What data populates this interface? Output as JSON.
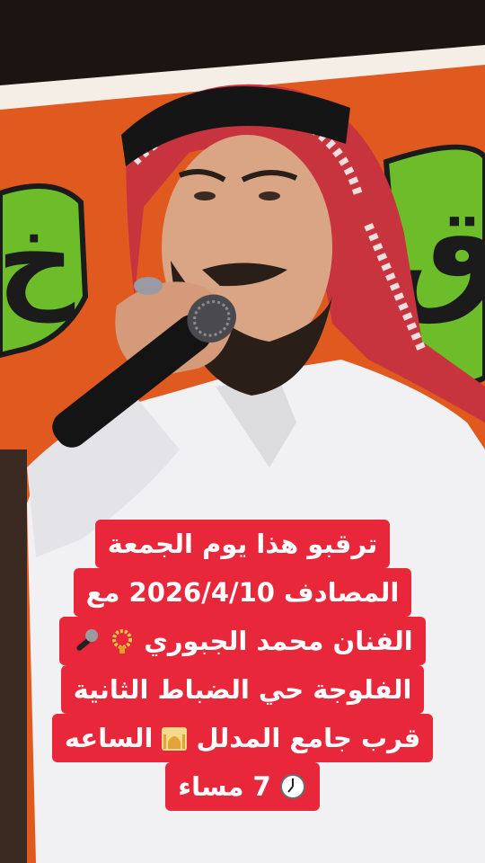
{
  "caption": {
    "line1": "ترقبو هذا يوم الجمعة",
    "line2": "المصادف 2026/4/10 مع",
    "line3": "الفنان محمد الجبوري",
    "line4": "الفلوجة حي الضباط الثانية",
    "line5_a": "قرب جامع المدلل",
    "line5_b": "الساعه",
    "line6": "7 مساء"
  },
  "banner": {
    "letter1": "ق",
    "letter2": "خ"
  },
  "colors": {
    "caption_bg": "#e8283a",
    "banner_orange": "#e05a20",
    "banner_green": "#6dbd2a"
  }
}
